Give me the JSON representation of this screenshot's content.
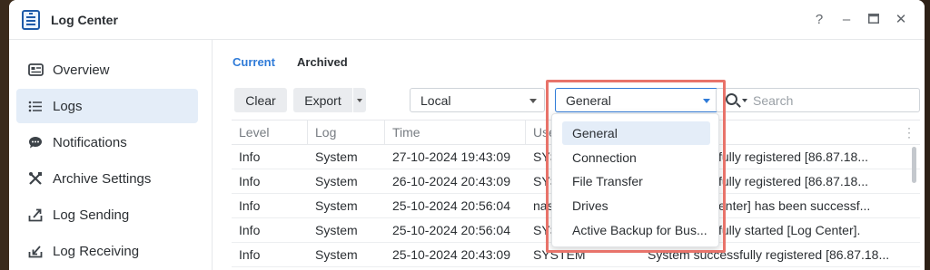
{
  "window": {
    "title": "Log Center",
    "controls": {
      "help": "?",
      "minimize": "–",
      "maximize": "▭",
      "close": "✕"
    }
  },
  "sidebar": {
    "items": [
      {
        "label": "Overview",
        "icon": "overview-icon",
        "active": false
      },
      {
        "label": "Logs",
        "icon": "list-icon",
        "active": true
      },
      {
        "label": "Notifications",
        "icon": "chat-bubble-icon",
        "active": false
      },
      {
        "label": "Archive Settings",
        "icon": "tools-icon",
        "active": false
      },
      {
        "label": "Log Sending",
        "icon": "upload-icon",
        "active": false
      },
      {
        "label": "Log Receiving",
        "icon": "download-icon",
        "active": false
      }
    ]
  },
  "tabs": [
    {
      "label": "Current",
      "active": true
    },
    {
      "label": "Archived",
      "active": false
    }
  ],
  "toolbar": {
    "clear_label": "Clear",
    "export_label": "Export",
    "source_select": "Local",
    "category_select": "General",
    "search_placeholder": "Search"
  },
  "table": {
    "columns": [
      "Level",
      "Log",
      "Time",
      "Use"
    ],
    "rows": [
      {
        "level": "Info",
        "log": "System",
        "time": "27-10-2024 19:43:09",
        "user": "SYS",
        "event": "fully registered [86.87.18..."
      },
      {
        "level": "Info",
        "log": "System",
        "time": "26-10-2024 20:43:09",
        "user": "SYS",
        "event": "fully registered [86.87.18..."
      },
      {
        "level": "Info",
        "log": "System",
        "time": "25-10-2024 20:56:04",
        "user": "nas",
        "event": "enter] has been successf..."
      },
      {
        "level": "Info",
        "log": "System",
        "time": "25-10-2024 20:56:04",
        "user": "SYS",
        "event": "fully started [Log Center]."
      },
      {
        "level": "Info",
        "log": "System",
        "time": "25-10-2024 20:43:09",
        "user": "SYSTEM",
        "event": "System successfully registered [86.87.18..."
      }
    ]
  },
  "dropdown": {
    "options": [
      "General",
      "Connection",
      "File Transfer",
      "Drives",
      "Active Backup for Bus..."
    ],
    "selected": "General"
  },
  "colors": {
    "accent": "#2f7bd8",
    "highlight_border": "#e8736a",
    "active_bg": "#e4edf8"
  }
}
